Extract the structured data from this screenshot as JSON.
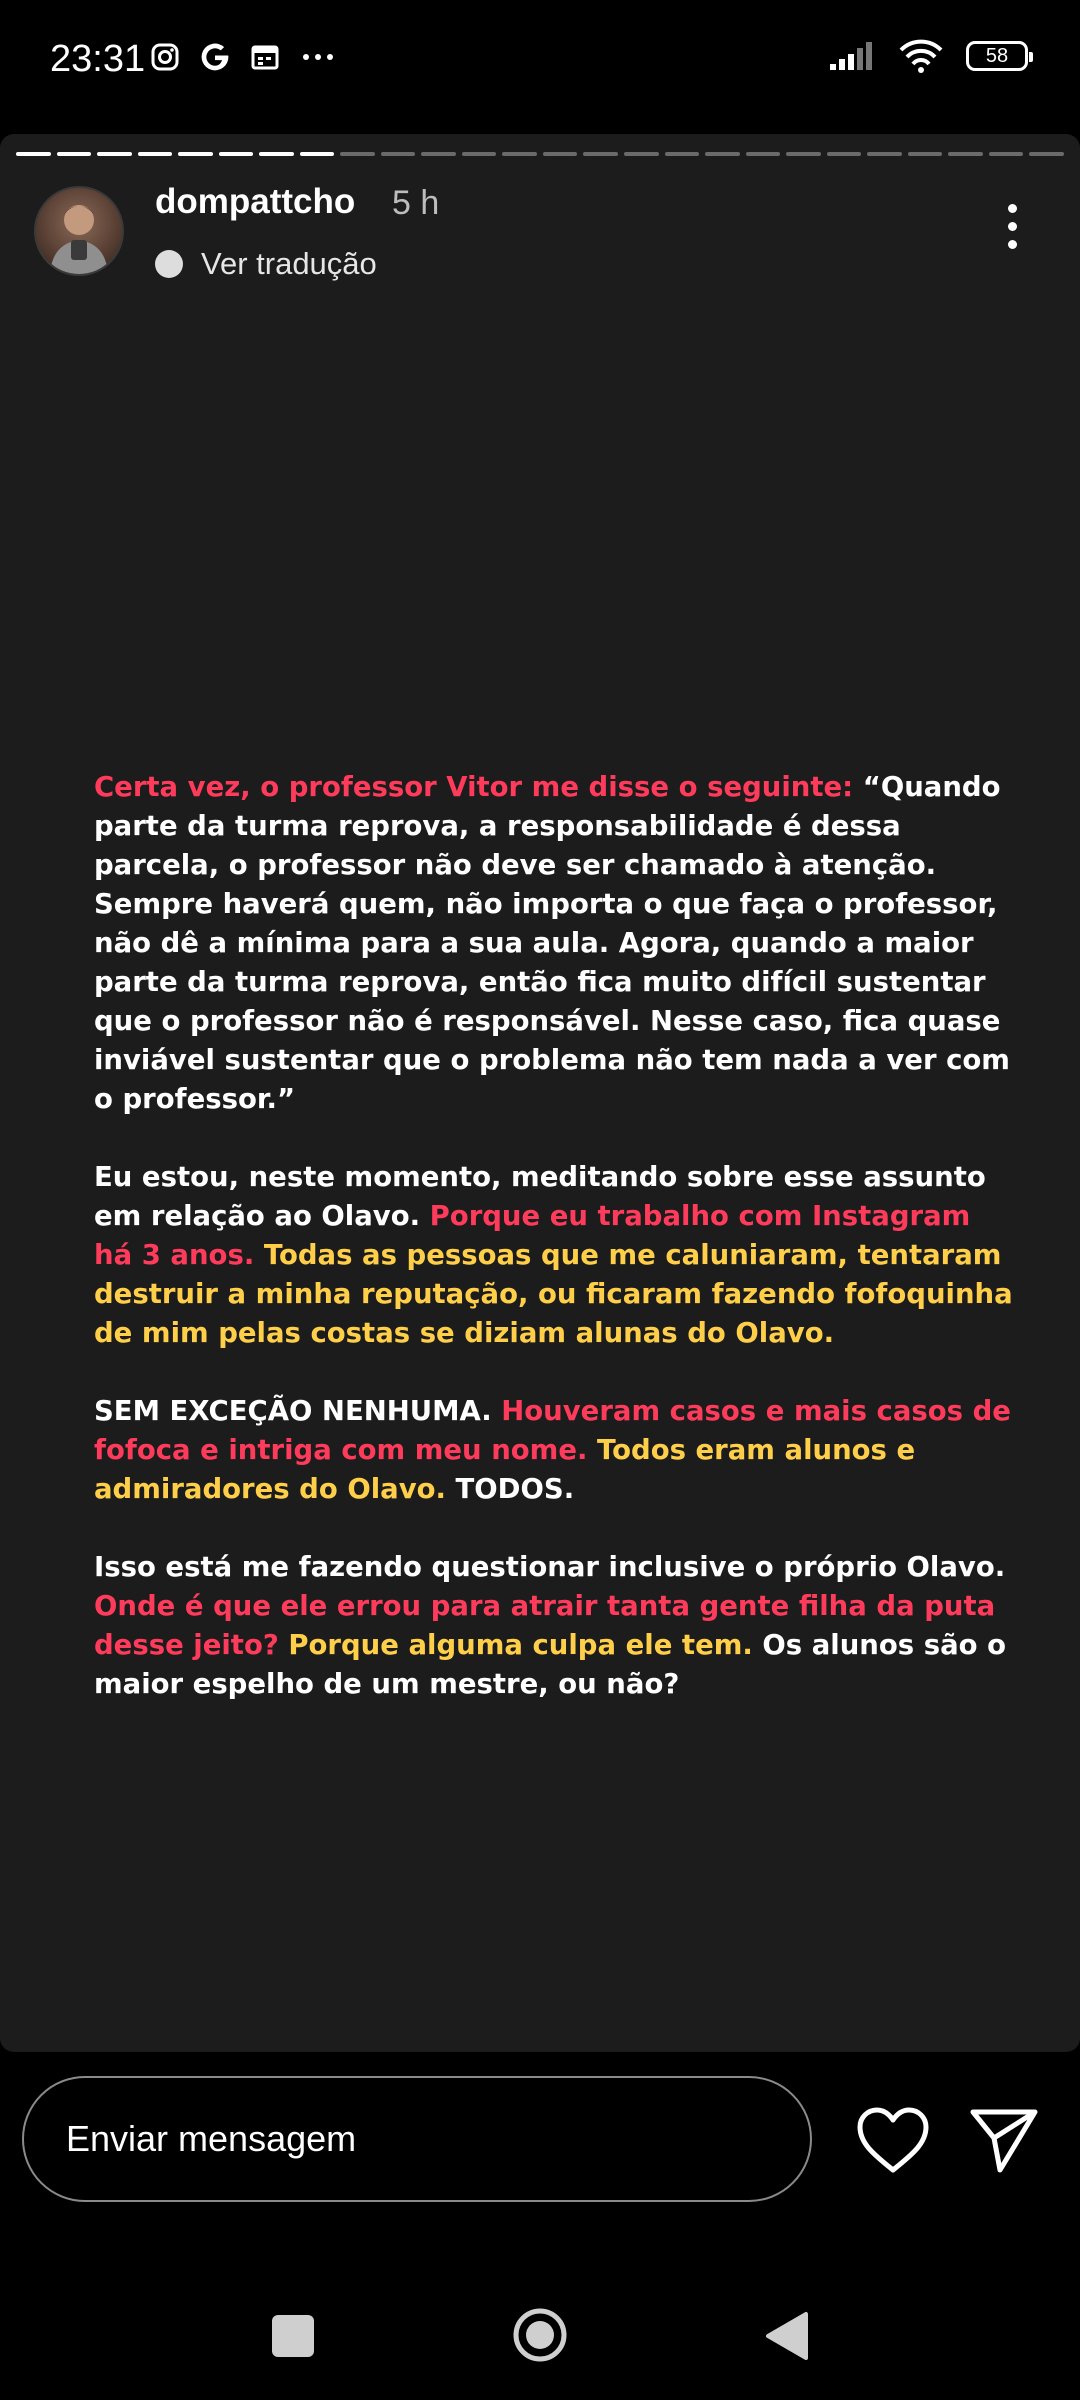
{
  "status_bar": {
    "time": "23:31",
    "left_icons": [
      "instagram-icon",
      "google-icon",
      "calendar-icon",
      "more-notifications-icon"
    ],
    "battery": "58"
  },
  "story": {
    "username": "dompattcho",
    "time_ago": "5 h",
    "translate_label": "Ver tradução",
    "progress": {
      "done_segments": 8,
      "total_segments": 26
    }
  },
  "post": {
    "p1": [
      {
        "text": "Certa vez, o professor Vitor me disse o seguinte:",
        "color": "red"
      },
      {
        "text": " “Quando parte da turma reprova, a responsabilidade é dessa parcela, o professor não deve ser chamado à atenção. Sempre haverá quem, não importa o que faça o professor, não dê a mínima para a sua aula. Agora, quando a maior parte da turma reprova, então fica muito difícil sustentar que o professor não é responsável. Nesse caso, fica quase inviável sustentar que o problema não tem nada a ver com o professor.”",
        "color": "white"
      }
    ],
    "p2": [
      {
        "text": "Eu estou, neste momento, meditando sobre esse assunto em relação ao Olavo. ",
        "color": "white"
      },
      {
        "text": "Porque eu trabalho com Instagram há 3 anos.",
        "color": "red"
      },
      {
        "text": " Todas as pessoas que me caluniaram, tentaram destruir a minha reputação, ou ficaram fazendo fofoquinha de mim pelas costas se diziam alunas do Olavo.",
        "color": "yellow"
      }
    ],
    "p3": [
      {
        "text": "SEM EXCEÇÃO NENHUMA. ",
        "color": "white"
      },
      {
        "text": "Houveram casos e mais casos de fofoca e intriga com meu nome.",
        "color": "red"
      },
      {
        "text": " Todos eram alunos e admiradores do Olavo.",
        "color": "yellow"
      },
      {
        "text": " TODOS.",
        "color": "white"
      }
    ],
    "p4": [
      {
        "text": "Isso está me fazendo questionar inclusive o próprio Olavo. ",
        "color": "white"
      },
      {
        "text": "Onde é que ele errou para atrair tanta gente filha da puta desse jeito?",
        "color": "red"
      },
      {
        "text": " Porque alguma culpa ele tem.",
        "color": "yellow"
      },
      {
        "text": " Os alunos são o maior espelho de um mestre, ou não?",
        "color": "white"
      }
    ]
  },
  "footer": {
    "message_placeholder": "Enviar mensagem",
    "like_icon": "heart-icon",
    "share_icon": "send-icon"
  },
  "nav": {
    "icons": [
      "recents-square-icon",
      "home-circle-icon",
      "back-triangle-icon"
    ]
  },
  "colors": {
    "red": "#ff3b5c",
    "yellow": "#ffcf4a",
    "white": "#ffffff",
    "story_bg": "#1c1c1c"
  }
}
